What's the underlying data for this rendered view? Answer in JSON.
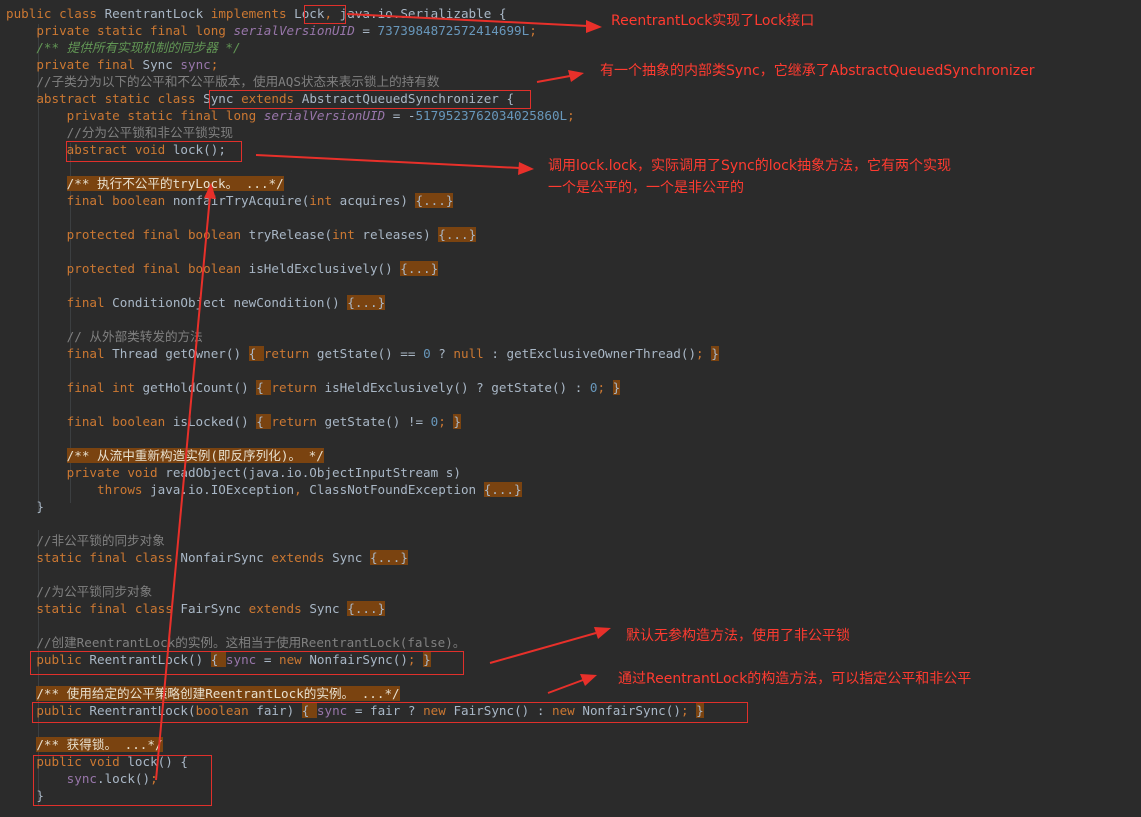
{
  "code_lines": [
    [
      {
        "t": "public class ",
        "c": "kw"
      },
      {
        "t": "ReentrantLock ",
        "c": "plain"
      },
      {
        "t": "implements ",
        "c": "kw"
      },
      {
        "t": "Lock",
        "c": "plain"
      },
      {
        "t": ", ",
        "c": "kw"
      },
      {
        "t": "java.io.Serializable ",
        "c": "plain"
      },
      {
        "t": "{",
        "c": "plain"
      }
    ],
    [
      {
        "t": "    private static final long ",
        "c": "kw"
      },
      {
        "t": "serialVersionUID",
        "c": "ifield"
      },
      {
        "t": " = ",
        "c": "plain"
      },
      {
        "t": "7373984872572414699L",
        "c": "num"
      },
      {
        "t": ";",
        "c": "kw"
      }
    ],
    [
      {
        "t": "    /** 提供所有实现机制的同步器 */",
        "c": "doc"
      }
    ],
    [
      {
        "t": "    private final ",
        "c": "kw"
      },
      {
        "t": "Sync ",
        "c": "plain"
      },
      {
        "t": "sync",
        "c": "field"
      },
      {
        "t": ";",
        "c": "kw"
      }
    ],
    [
      {
        "t": "    //子类分为以下的公平和不公平版本，使用AQS状态来表示锁上的持有数",
        "c": "cmt"
      }
    ],
    [
      {
        "t": "    abstract static class ",
        "c": "kw"
      },
      {
        "t": "Sync ",
        "c": "plain"
      },
      {
        "t": "extends ",
        "c": "kw"
      },
      {
        "t": "AbstractQueuedSynchronizer ",
        "c": "plain"
      },
      {
        "t": "{",
        "c": "plain"
      }
    ],
    [
      {
        "t": "        private static final long ",
        "c": "kw"
      },
      {
        "t": "serialVersionUID",
        "c": "ifield"
      },
      {
        "t": " = -",
        "c": "plain"
      },
      {
        "t": "5179523762034025860L",
        "c": "num"
      },
      {
        "t": ";",
        "c": "kw"
      }
    ],
    [
      {
        "t": "        //分为公平锁和非公平锁实现",
        "c": "cmt"
      }
    ],
    [
      {
        "t": "        abstract void ",
        "c": "kw"
      },
      {
        "t": "lock",
        "c": "plain"
      },
      {
        "t": "();",
        "c": "plain"
      }
    ],
    [],
    [
      {
        "t": "        ",
        "c": "plain"
      },
      {
        "t": "/** 执行不公平的tryLock。 ...*/",
        "c": "docfold"
      }
    ],
    [
      {
        "t": "        final boolean ",
        "c": "kw"
      },
      {
        "t": "nonfairTryAcquire",
        "c": "plain"
      },
      {
        "t": "(",
        "c": "plain"
      },
      {
        "t": "int ",
        "c": "kw"
      },
      {
        "t": "acquires) ",
        "c": "plain"
      },
      {
        "t": "{...}",
        "c": "fold"
      }
    ],
    [],
    [
      {
        "t": "        protected final boolean ",
        "c": "kw"
      },
      {
        "t": "tryRelease",
        "c": "plain"
      },
      {
        "t": "(",
        "c": "plain"
      },
      {
        "t": "int ",
        "c": "kw"
      },
      {
        "t": "releases) ",
        "c": "plain"
      },
      {
        "t": "{...}",
        "c": "fold"
      }
    ],
    [],
    [
      {
        "t": "        protected final boolean ",
        "c": "kw"
      },
      {
        "t": "isHeldExclusively",
        "c": "plain"
      },
      {
        "t": "() ",
        "c": "plain"
      },
      {
        "t": "{...}",
        "c": "fold"
      }
    ],
    [],
    [
      {
        "t": "        final ",
        "c": "kw"
      },
      {
        "t": "ConditionObject ",
        "c": "plain"
      },
      {
        "t": "newCondition",
        "c": "plain"
      },
      {
        "t": "() ",
        "c": "plain"
      },
      {
        "t": "{...}",
        "c": "fold"
      }
    ],
    [],
    [
      {
        "t": "        // 从外部类转发的方法",
        "c": "cmt"
      }
    ],
    [
      {
        "t": "        final ",
        "c": "kw"
      },
      {
        "t": "Thread ",
        "c": "plain"
      },
      {
        "t": "getOwner",
        "c": "plain"
      },
      {
        "t": "() ",
        "c": "plain"
      },
      {
        "t": "{ ",
        "c": "fold"
      },
      {
        "t": "return ",
        "c": "kw"
      },
      {
        "t": "getState() == ",
        "c": "plain"
      },
      {
        "t": "0 ",
        "c": "num"
      },
      {
        "t": "? ",
        "c": "plain"
      },
      {
        "t": "null ",
        "c": "kw"
      },
      {
        "t": ": getExclusiveOwnerThread()",
        "c": "plain"
      },
      {
        "t": "; ",
        "c": "kw"
      },
      {
        "t": "}",
        "c": "fold"
      }
    ],
    [],
    [
      {
        "t": "        final int ",
        "c": "kw"
      },
      {
        "t": "getHoldCount",
        "c": "plain"
      },
      {
        "t": "() ",
        "c": "plain"
      },
      {
        "t": "{ ",
        "c": "fold"
      },
      {
        "t": "return ",
        "c": "kw"
      },
      {
        "t": "isHeldExclusively() ? getState() : ",
        "c": "plain"
      },
      {
        "t": "0",
        "c": "num"
      },
      {
        "t": "; ",
        "c": "kw"
      },
      {
        "t": "}",
        "c": "fold"
      }
    ],
    [],
    [
      {
        "t": "        final boolean ",
        "c": "kw"
      },
      {
        "t": "isLocked",
        "c": "plain"
      },
      {
        "t": "() ",
        "c": "plain"
      },
      {
        "t": "{ ",
        "c": "fold"
      },
      {
        "t": "return ",
        "c": "kw"
      },
      {
        "t": "getState() != ",
        "c": "plain"
      },
      {
        "t": "0",
        "c": "num"
      },
      {
        "t": "; ",
        "c": "kw"
      },
      {
        "t": "}",
        "c": "fold"
      }
    ],
    [],
    [
      {
        "t": "        ",
        "c": "plain"
      },
      {
        "t": "/** 从流中重新构造实例(即反序列化)。 */",
        "c": "docfold"
      }
    ],
    [
      {
        "t": "        private void ",
        "c": "kw"
      },
      {
        "t": "readObject",
        "c": "plain"
      },
      {
        "t": "(java.io.ObjectInputStream s)",
        "c": "plain"
      }
    ],
    [
      {
        "t": "            throws ",
        "c": "kw"
      },
      {
        "t": "java.io.IOException",
        "c": "plain"
      },
      {
        "t": ", ",
        "c": "kw"
      },
      {
        "t": "ClassNotFoundException ",
        "c": "plain"
      },
      {
        "t": "{...}",
        "c": "fold"
      }
    ],
    [
      {
        "t": "    }",
        "c": "plain"
      }
    ],
    [],
    [
      {
        "t": "    //非公平锁的同步对象",
        "c": "cmt"
      }
    ],
    [
      {
        "t": "    static final class ",
        "c": "kw"
      },
      {
        "t": "NonfairSync ",
        "c": "plain"
      },
      {
        "t": "extends ",
        "c": "kw"
      },
      {
        "t": "Sync ",
        "c": "plain"
      },
      {
        "t": "{...}",
        "c": "fold"
      }
    ],
    [],
    [
      {
        "t": "    //为公平锁同步对象",
        "c": "cmt"
      }
    ],
    [
      {
        "t": "    static final class ",
        "c": "kw"
      },
      {
        "t": "FairSync ",
        "c": "plain"
      },
      {
        "t": "extends ",
        "c": "kw"
      },
      {
        "t": "Sync ",
        "c": "plain"
      },
      {
        "t": "{...}",
        "c": "fold"
      }
    ],
    [],
    [
      {
        "t": "    //创建ReentrantLock的实例。这相当于使用ReentrantLock(false)。",
        "c": "cmt"
      }
    ],
    [
      {
        "t": "    public ",
        "c": "kw"
      },
      {
        "t": "ReentrantLock",
        "c": "plain"
      },
      {
        "t": "() ",
        "c": "plain"
      },
      {
        "t": "{ ",
        "c": "fold"
      },
      {
        "t": "sync",
        "c": "field"
      },
      {
        "t": " = ",
        "c": "plain"
      },
      {
        "t": "new ",
        "c": "kw"
      },
      {
        "t": "NonfairSync()",
        "c": "plain"
      },
      {
        "t": "; ",
        "c": "kw"
      },
      {
        "t": "}",
        "c": "fold"
      }
    ],
    [],
    [
      {
        "t": "    ",
        "c": "plain"
      },
      {
        "t": "/** 使用给定的公平策略创建ReentrantLock的实例。 ...*/",
        "c": "docfold"
      }
    ],
    [
      {
        "t": "    public ",
        "c": "kw"
      },
      {
        "t": "ReentrantLock",
        "c": "plain"
      },
      {
        "t": "(",
        "c": "plain"
      },
      {
        "t": "boolean ",
        "c": "kw"
      },
      {
        "t": "fair) ",
        "c": "plain"
      },
      {
        "t": "{ ",
        "c": "fold"
      },
      {
        "t": "sync",
        "c": "field"
      },
      {
        "t": " = fair ? ",
        "c": "plain"
      },
      {
        "t": "new ",
        "c": "kw"
      },
      {
        "t": "FairSync() : ",
        "c": "plain"
      },
      {
        "t": "new ",
        "c": "kw"
      },
      {
        "t": "NonfairSync()",
        "c": "plain"
      },
      {
        "t": "; ",
        "c": "kw"
      },
      {
        "t": "}",
        "c": "fold"
      }
    ],
    [],
    [
      {
        "t": "    ",
        "c": "plain"
      },
      {
        "t": "/** 获得锁。 ...*/",
        "c": "docfold"
      }
    ],
    [
      {
        "t": "    public void ",
        "c": "kw"
      },
      {
        "t": "lock",
        "c": "plain"
      },
      {
        "t": "() {",
        "c": "plain"
      }
    ],
    [
      {
        "t": "        ",
        "c": "plain"
      },
      {
        "t": "sync",
        "c": "field"
      },
      {
        "t": ".lock()",
        "c": "plain"
      },
      {
        "t": ";",
        "c": "kw"
      }
    ],
    [
      {
        "t": "    }",
        "c": "plain"
      }
    ]
  ],
  "annotations": {
    "note_implements": "ReentrantLock实现了Lock接口",
    "note_sync": "有一个抽象的内部类Sync，它继承了AbstractQueuedSynchronizer",
    "note_lock_line1": "调用lock.lock，实际调用了Sync的lock抽象方法，它有两个实现",
    "note_lock_line2": "一个是公平的，一个是非公平的",
    "note_default": "默认无参构造方法，使用了非公平锁",
    "note_fair": "通过ReentrantLock的构造方法，可以指定公平和非公平"
  },
  "colors": {
    "background": "#2b2b2b",
    "keyword": "#cc7832",
    "identifier": "#a9b7c6",
    "number": "#6897bb",
    "field": "#9876aa",
    "comment": "#808080",
    "doc_comment": "#629755",
    "fold_highlight": "#7a4310",
    "annotation_red": "#ff3b30"
  }
}
